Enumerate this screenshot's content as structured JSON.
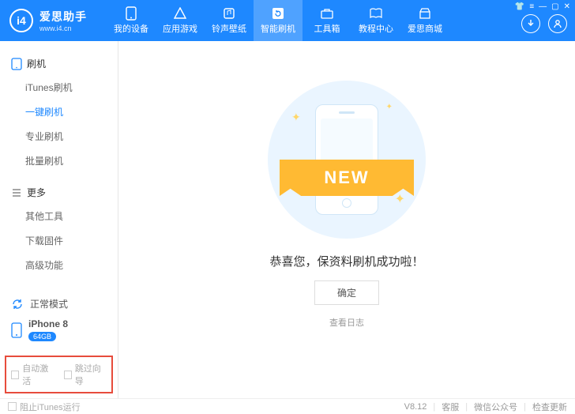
{
  "header": {
    "brand_cn": "爱思助手",
    "brand_en": "www.i4.cn",
    "logo_mark": "i4",
    "nav": [
      {
        "label": "我的设备",
        "icon": "phone"
      },
      {
        "label": "应用游戏",
        "icon": "apps"
      },
      {
        "label": "铃声壁纸",
        "icon": "music"
      },
      {
        "label": "智能刷机",
        "icon": "refresh",
        "active": true
      },
      {
        "label": "工具箱",
        "icon": "toolbox"
      },
      {
        "label": "教程中心",
        "icon": "book"
      },
      {
        "label": "爱思商城",
        "icon": "shop"
      }
    ],
    "window_controls": [
      "tshirt",
      "menu",
      "min",
      "max",
      "close"
    ]
  },
  "sidebar": {
    "group1": {
      "title": "刷机",
      "items": [
        {
          "label": "iTunes刷机"
        },
        {
          "label": "一键刷机",
          "active": true
        },
        {
          "label": "专业刷机"
        },
        {
          "label": "批量刷机"
        }
      ]
    },
    "group2": {
      "title": "更多",
      "items": [
        {
          "label": "其他工具"
        },
        {
          "label": "下载固件"
        },
        {
          "label": "高级功能"
        }
      ]
    },
    "mode_label": "正常模式",
    "device": {
      "name": "iPhone 8",
      "badge": "64GB"
    },
    "opt1": "自动激活",
    "opt2": "跳过向导"
  },
  "main": {
    "ribbon_text": "NEW",
    "success_message": "恭喜您，保资料刷机成功啦！",
    "confirm_label": "确定",
    "log_link": "查看日志"
  },
  "footer": {
    "block_itunes": "阻止iTunes运行",
    "version": "V8.12",
    "link1": "客服",
    "link2": "微信公众号",
    "link3": "检查更新"
  }
}
